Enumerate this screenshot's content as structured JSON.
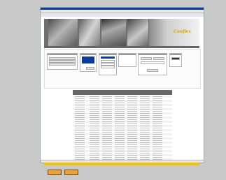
{
  "window": {
    "logo": "Conflex"
  },
  "columns": [
    "",
    "",
    "",
    "",
    "",
    "",
    ""
  ],
  "rows": [
    [
      "",
      "",
      "",
      "",
      "",
      "",
      ""
    ],
    [
      "",
      "",
      "",
      "",
      "",
      "",
      ""
    ],
    [
      "",
      "",
      "",
      "",
      "",
      "",
      ""
    ],
    [
      "",
      "",
      "",
      "",
      "",
      "",
      ""
    ],
    [
      "",
      "",
      "",
      "",
      "",
      "",
      ""
    ],
    [
      "",
      "",
      "",
      "",
      "",
      "",
      ""
    ],
    [
      "",
      "",
      "",
      "",
      "",
      "",
      ""
    ],
    [
      "",
      "",
      "",
      "",
      "",
      "",
      ""
    ],
    [
      "",
      "",
      "",
      "",
      "",
      "",
      ""
    ],
    [
      "",
      "",
      "",
      "",
      "",
      "",
      ""
    ],
    [
      "",
      "",
      "",
      "",
      "",
      "",
      ""
    ],
    [
      "",
      "",
      "",
      "",
      "",
      "",
      ""
    ],
    [
      "",
      "",
      "",
      "",
      "",
      "",
      ""
    ],
    [
      "",
      "",
      "",
      "",
      "",
      "",
      ""
    ],
    [
      "",
      "",
      "",
      "",
      "",
      "",
      ""
    ],
    [
      "",
      "",
      "",
      "",
      "",
      "",
      ""
    ],
    [
      "",
      "",
      "",
      "",
      "",
      "",
      ""
    ],
    [
      "",
      "",
      "",
      "",
      "",
      "",
      ""
    ],
    [
      "",
      "",
      "",
      "",
      "",
      "",
      ""
    ],
    [
      "",
      "",
      "",
      "",
      "",
      "",
      ""
    ],
    [
      "",
      "",
      "",
      "",
      "",
      "",
      ""
    ],
    [
      "",
      "",
      "",
      "",
      "",
      "",
      ""
    ],
    [
      "",
      "",
      "",
      "",
      "",
      "",
      ""
    ],
    [
      "",
      "",
      "",
      "",
      "",
      "",
      ""
    ],
    [
      "",
      "",
      "",
      "",
      "",
      "",
      ""
    ],
    [
      "",
      "",
      "",
      "",
      "",
      "",
      ""
    ],
    [
      "",
      "",
      "",
      "",
      "",
      "",
      ""
    ],
    [
      "",
      "",
      "",
      "",
      "",
      "",
      ""
    ],
    [
      "",
      "",
      "",
      "",
      "",
      "",
      ""
    ],
    [
      "",
      "",
      "",
      "",
      "",
      "",
      ""
    ],
    [
      "",
      "",
      "",
      "",
      "",
      "",
      ""
    ]
  ],
  "colors": {
    "header": "#666666",
    "selection": "#0b3b9e",
    "footer": "#f1c200",
    "logo": "#d8a400"
  },
  "taskbar": {
    "items": [
      "",
      ""
    ]
  }
}
